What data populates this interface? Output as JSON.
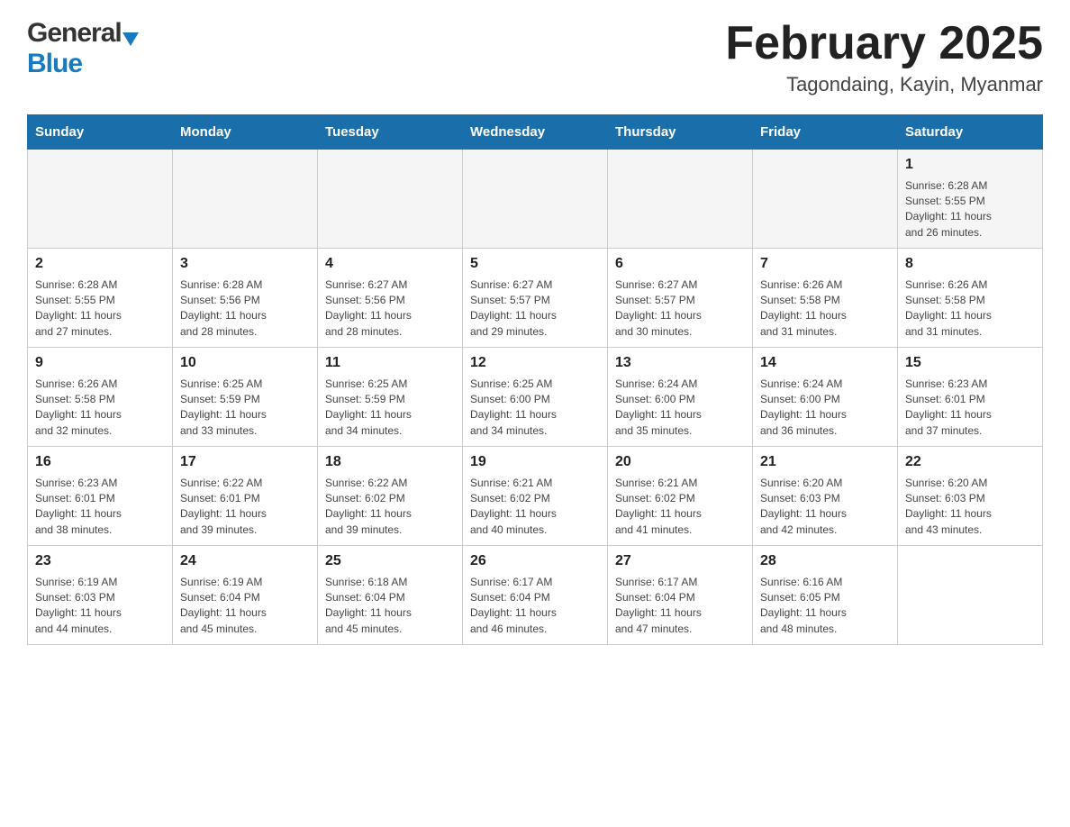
{
  "header": {
    "logo_general": "General",
    "logo_blue": "Blue",
    "title": "February 2025",
    "subtitle": "Tagondaing, Kayin, Myanmar"
  },
  "calendar": {
    "days": [
      "Sunday",
      "Monday",
      "Tuesday",
      "Wednesday",
      "Thursday",
      "Friday",
      "Saturday"
    ],
    "weeks": [
      [
        {
          "day": "",
          "info": ""
        },
        {
          "day": "",
          "info": ""
        },
        {
          "day": "",
          "info": ""
        },
        {
          "day": "",
          "info": ""
        },
        {
          "day": "",
          "info": ""
        },
        {
          "day": "",
          "info": ""
        },
        {
          "day": "1",
          "info": "Sunrise: 6:28 AM\nSunset: 5:55 PM\nDaylight: 11 hours\nand 26 minutes."
        }
      ],
      [
        {
          "day": "2",
          "info": "Sunrise: 6:28 AM\nSunset: 5:55 PM\nDaylight: 11 hours\nand 27 minutes."
        },
        {
          "day": "3",
          "info": "Sunrise: 6:28 AM\nSunset: 5:56 PM\nDaylight: 11 hours\nand 28 minutes."
        },
        {
          "day": "4",
          "info": "Sunrise: 6:27 AM\nSunset: 5:56 PM\nDaylight: 11 hours\nand 28 minutes."
        },
        {
          "day": "5",
          "info": "Sunrise: 6:27 AM\nSunset: 5:57 PM\nDaylight: 11 hours\nand 29 minutes."
        },
        {
          "day": "6",
          "info": "Sunrise: 6:27 AM\nSunset: 5:57 PM\nDaylight: 11 hours\nand 30 minutes."
        },
        {
          "day": "7",
          "info": "Sunrise: 6:26 AM\nSunset: 5:58 PM\nDaylight: 11 hours\nand 31 minutes."
        },
        {
          "day": "8",
          "info": "Sunrise: 6:26 AM\nSunset: 5:58 PM\nDaylight: 11 hours\nand 31 minutes."
        }
      ],
      [
        {
          "day": "9",
          "info": "Sunrise: 6:26 AM\nSunset: 5:58 PM\nDaylight: 11 hours\nand 32 minutes."
        },
        {
          "day": "10",
          "info": "Sunrise: 6:25 AM\nSunset: 5:59 PM\nDaylight: 11 hours\nand 33 minutes."
        },
        {
          "day": "11",
          "info": "Sunrise: 6:25 AM\nSunset: 5:59 PM\nDaylight: 11 hours\nand 34 minutes."
        },
        {
          "day": "12",
          "info": "Sunrise: 6:25 AM\nSunset: 6:00 PM\nDaylight: 11 hours\nand 34 minutes."
        },
        {
          "day": "13",
          "info": "Sunrise: 6:24 AM\nSunset: 6:00 PM\nDaylight: 11 hours\nand 35 minutes."
        },
        {
          "day": "14",
          "info": "Sunrise: 6:24 AM\nSunset: 6:00 PM\nDaylight: 11 hours\nand 36 minutes."
        },
        {
          "day": "15",
          "info": "Sunrise: 6:23 AM\nSunset: 6:01 PM\nDaylight: 11 hours\nand 37 minutes."
        }
      ],
      [
        {
          "day": "16",
          "info": "Sunrise: 6:23 AM\nSunset: 6:01 PM\nDaylight: 11 hours\nand 38 minutes."
        },
        {
          "day": "17",
          "info": "Sunrise: 6:22 AM\nSunset: 6:01 PM\nDaylight: 11 hours\nand 39 minutes."
        },
        {
          "day": "18",
          "info": "Sunrise: 6:22 AM\nSunset: 6:02 PM\nDaylight: 11 hours\nand 39 minutes."
        },
        {
          "day": "19",
          "info": "Sunrise: 6:21 AM\nSunset: 6:02 PM\nDaylight: 11 hours\nand 40 minutes."
        },
        {
          "day": "20",
          "info": "Sunrise: 6:21 AM\nSunset: 6:02 PM\nDaylight: 11 hours\nand 41 minutes."
        },
        {
          "day": "21",
          "info": "Sunrise: 6:20 AM\nSunset: 6:03 PM\nDaylight: 11 hours\nand 42 minutes."
        },
        {
          "day": "22",
          "info": "Sunrise: 6:20 AM\nSunset: 6:03 PM\nDaylight: 11 hours\nand 43 minutes."
        }
      ],
      [
        {
          "day": "23",
          "info": "Sunrise: 6:19 AM\nSunset: 6:03 PM\nDaylight: 11 hours\nand 44 minutes."
        },
        {
          "day": "24",
          "info": "Sunrise: 6:19 AM\nSunset: 6:04 PM\nDaylight: 11 hours\nand 45 minutes."
        },
        {
          "day": "25",
          "info": "Sunrise: 6:18 AM\nSunset: 6:04 PM\nDaylight: 11 hours\nand 45 minutes."
        },
        {
          "day": "26",
          "info": "Sunrise: 6:17 AM\nSunset: 6:04 PM\nDaylight: 11 hours\nand 46 minutes."
        },
        {
          "day": "27",
          "info": "Sunrise: 6:17 AM\nSunset: 6:04 PM\nDaylight: 11 hours\nand 47 minutes."
        },
        {
          "day": "28",
          "info": "Sunrise: 6:16 AM\nSunset: 6:05 PM\nDaylight: 11 hours\nand 48 minutes."
        },
        {
          "day": "",
          "info": ""
        }
      ]
    ]
  }
}
